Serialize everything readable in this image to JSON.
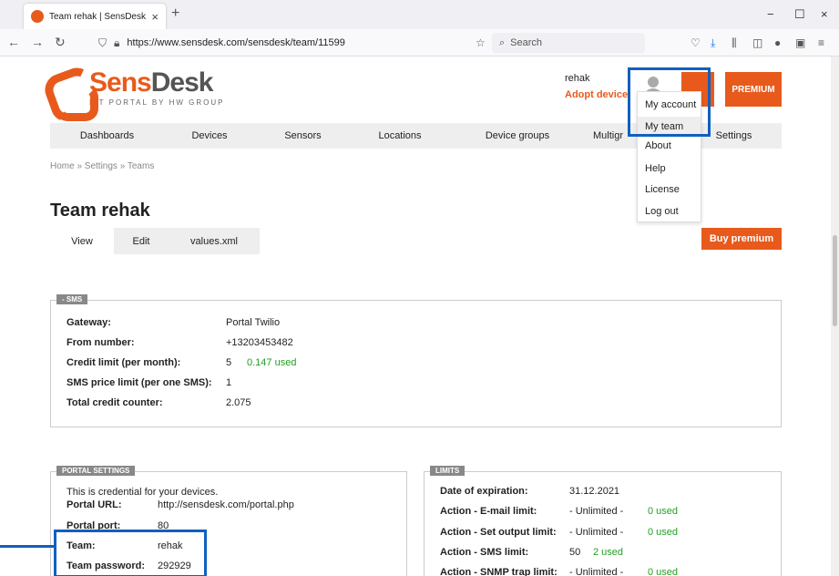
{
  "browser": {
    "tab_title": "Team rehak | SensDesk",
    "url": "https://www.sensdesk.com/sensdesk/team/11599",
    "search_placeholder": "Search"
  },
  "header": {
    "logo_part1": "Sens",
    "logo_part2": "Desk",
    "logo_sub": "IoT PORTAL BY HW GROUP",
    "username": "rehak",
    "adopt_label": "Adopt device",
    "premium_label": "PREMIUM"
  },
  "account_menu": {
    "items": [
      "My account",
      "My team",
      "About",
      "Help",
      "License",
      "Log out"
    ]
  },
  "nav": {
    "items": [
      "Dashboards",
      "Devices",
      "Sensors",
      "Locations",
      "Device groups",
      "Multigr",
      "Settings"
    ]
  },
  "breadcrumb": "Home » Settings » Teams",
  "page_title": "Team rehak",
  "subtabs": [
    "View",
    "Edit",
    "values.xml"
  ],
  "buy_label": "Buy premium",
  "sms": {
    "title": "- SMS",
    "rows": [
      {
        "label": "Gateway:",
        "value": "Portal Twilio",
        "used": ""
      },
      {
        "label": "From number:",
        "value": "+13203453482",
        "used": ""
      },
      {
        "label": "Credit limit (per month):",
        "value": "5",
        "used": "0.147 used"
      },
      {
        "label": "SMS price limit (per one SMS):",
        "value": "1",
        "used": ""
      },
      {
        "label": "Total credit counter:",
        "value": "2.075",
        "used": ""
      }
    ]
  },
  "portal": {
    "title": "PORTAL SETTINGS",
    "note": "This is credential for your devices.",
    "rows": [
      {
        "label": "Portal URL:",
        "value": "http://sensdesk.com/portal.php"
      },
      {
        "label": "Portal port:",
        "value": "80"
      },
      {
        "label": "Team:",
        "value": "rehak"
      },
      {
        "label": "Team password:",
        "value": "292929"
      }
    ]
  },
  "limits": {
    "title": "LIMITS",
    "rows": [
      {
        "label": "Date of expiration:",
        "value": "31.12.2021",
        "used": ""
      },
      {
        "label": "Action - E-mail limit:",
        "value": "- Unlimited -",
        "used": "0 used"
      },
      {
        "label": "Action - Set output limit:",
        "value": "- Unlimited -",
        "used": "0 used"
      },
      {
        "label": "Action - SMS limit:",
        "value": "50",
        "used": "2 used"
      },
      {
        "label": "Action - SNMP trap limit:",
        "value": "- Unlimited -",
        "used": "0 used"
      }
    ]
  }
}
